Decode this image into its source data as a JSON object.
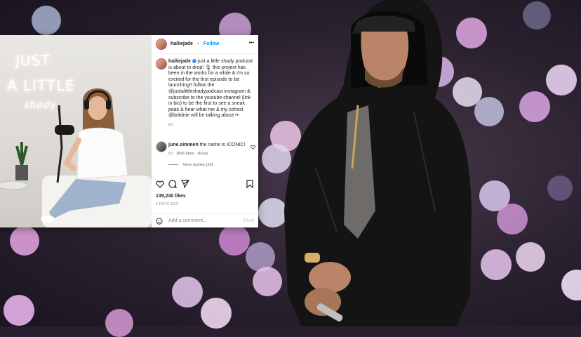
{
  "post": {
    "username": "hailiejade",
    "follow_label": "Follow",
    "more_label": "•••",
    "neon_line1": "JUST",
    "neon_line2": "A LITTLE",
    "neon_line3": "shady",
    "caption_user": "hailiejade",
    "caption_text": "just a little shady podcast is about to drop! 🎙 this project has been in the works for a while & i'm so excited for the first episode to be launching!! follow the @justalittleshadypodcast instagram & subscribe to the youtube channel (link in bio) to be the first to see a sneak peak & hear what me & my cohost @britdnie will be talking about ••",
    "caption_age": "6d",
    "comment_user": "june.simmen",
    "comment_text": "the name is ICONIC!",
    "comment_age": "6d",
    "comment_likes": "1843 likes",
    "comment_reply": "Reply",
    "view_replies": "View replies (10)",
    "likes": "139,240 likes",
    "posted_ago": "6 DAYS AGO",
    "add_comment_placeholder": "Add a comment...",
    "post_button": "Post"
  }
}
